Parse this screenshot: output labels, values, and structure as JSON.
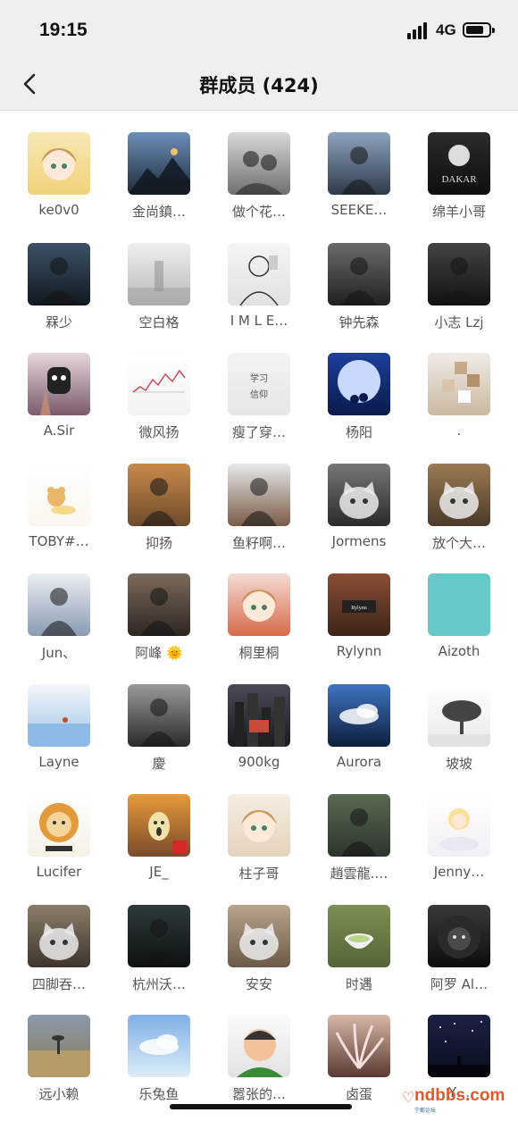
{
  "status_bar": {
    "time": "19:15",
    "network": "4G",
    "battery_percent": 80
  },
  "nav": {
    "title": "群成员 (424)",
    "back_icon": "chevron-left-icon"
  },
  "members": [
    {
      "name": "ke0v0",
      "bg1": "#f6e7b4",
      "bg2": "#f1d27a",
      "motif": "anime"
    },
    {
      "name": "金尚鎮…",
      "bg1": "#6c8fb8",
      "bg2": "#1f2a3b",
      "motif": "mountain"
    },
    {
      "name": "做个花…",
      "bg1": "#d9d9d9",
      "bg2": "#6f6f6f",
      "motif": "people"
    },
    {
      "name": "SEEKE…",
      "bg1": "#8fa3be",
      "bg2": "#2f3a4a",
      "motif": "person"
    },
    {
      "name": "绵羊小哥",
      "bg1": "#2b2b2b",
      "bg2": "#0f0f0f",
      "motif": "logo"
    },
    {
      "name": "槑少",
      "bg1": "#3e5166",
      "bg2": "#0f1820",
      "motif": "person"
    },
    {
      "name": "空白格",
      "bg1": "#eeeeee",
      "bg2": "#b9b9b9",
      "motif": "mist"
    },
    {
      "name": "I M L E…",
      "bg1": "#f5f5f5",
      "bg2": "#e1e1e1",
      "motif": "sketch"
    },
    {
      "name": "钟先森",
      "bg1": "#6b6b6b",
      "bg2": "#202020",
      "motif": "person"
    },
    {
      "name": "小志 Lzj",
      "bg1": "#444444",
      "bg2": "#111111",
      "motif": "person"
    },
    {
      "name": "A.Sir",
      "bg1": "#e7d7df",
      "bg2": "#7a5a6b",
      "motif": "mask"
    },
    {
      "name": "微风扬",
      "bg1": "#ffffff",
      "bg2": "#f2f2f2",
      "motif": "chart"
    },
    {
      "name": "瘦了穿…",
      "bg1": "#f3f3f3",
      "bg2": "#e6e6e6",
      "motif": "text"
    },
    {
      "name": "杨阳",
      "bg1": "#1d3f9c",
      "bg2": "#0a1a4a",
      "motif": "moon"
    },
    {
      "name": ".",
      "bg1": "#f0ece6",
      "bg2": "#c9b8a2",
      "motif": "blocks"
    },
    {
      "name": "TOBY#…",
      "bg1": "#ffffff",
      "bg2": "#fbf6ee",
      "motif": "bear"
    },
    {
      "name": "抑扬",
      "bg1": "#c98a4b",
      "bg2": "#6e4a2b",
      "motif": "person"
    },
    {
      "name": "鱼籽啊…",
      "bg1": "#e9e9e9",
      "bg2": "#7a5b48",
      "motif": "person"
    },
    {
      "name": "Jormens",
      "bg1": "#777777",
      "bg2": "#2a2a2a",
      "motif": "cat"
    },
    {
      "name": "放个大…",
      "bg1": "#9c7a52",
      "bg2": "#4a3a2a",
      "motif": "cat"
    },
    {
      "name": "Jun、",
      "bg1": "#eceff4",
      "bg2": "#8a9bb3",
      "motif": "person"
    },
    {
      "name": "阿峰 🌞",
      "bg1": "#7b6a5b",
      "bg2": "#2e2620",
      "motif": "person"
    },
    {
      "name": "桐里桐",
      "bg1": "#f4dbd4",
      "bg2": "#d76a4a",
      "motif": "anime"
    },
    {
      "name": "Rylynn",
      "bg1": "#8a4e35",
      "bg2": "#3b2418",
      "motif": "label"
    },
    {
      "name": "Aizoth",
      "bg1": "#66c9c7",
      "bg2": "#66c9c7",
      "motif": "plain"
    },
    {
      "name": "Layne",
      "bg1": "#f4f7fb",
      "bg2": "#9ec3e6",
      "motif": "water"
    },
    {
      "name": "慶",
      "bg1": "#9a9a9a",
      "bg2": "#2a2a2a",
      "motif": "person"
    },
    {
      "name": "900kg",
      "bg1": "#4a4a5a",
      "bg2": "#1a1a22",
      "motif": "city"
    },
    {
      "name": "Aurora",
      "bg1": "#3f74c2",
      "bg2": "#0d1f3c",
      "motif": "cloud"
    },
    {
      "name": "坡坡",
      "bg1": "#ffffff",
      "bg2": "#e9e9e9",
      "motif": "tree"
    },
    {
      "name": "Lucifer",
      "bg1": "#ffffff",
      "bg2": "#f6f1e6",
      "motif": "lion"
    },
    {
      "name": "JE_",
      "bg1": "#e79a3a",
      "bg2": "#7a4a2a",
      "motif": "scream"
    },
    {
      "name": "柱子哥",
      "bg1": "#f4ede3",
      "bg2": "#e5d3bd",
      "motif": "anime"
    },
    {
      "name": "趙雲龍.…",
      "bg1": "#5a6a52",
      "bg2": "#2c342a",
      "motif": "person"
    },
    {
      "name": "Jenny…",
      "bg1": "#ffffff",
      "bg2": "#f3eef6",
      "motif": "girl"
    },
    {
      "name": "四脚吞…",
      "bg1": "#8b7d6c",
      "bg2": "#3e352c",
      "motif": "cat"
    },
    {
      "name": "杭州沃…",
      "bg1": "#2d3a3c",
      "bg2": "#0d1112",
      "motif": "person"
    },
    {
      "name": "安安",
      "bg1": "#b9a48c",
      "bg2": "#6b5a48",
      "motif": "cat"
    },
    {
      "name": "时遇",
      "bg1": "#7d8f54",
      "bg2": "#556535",
      "motif": "cup"
    },
    {
      "name": "阿罗 Al…",
      "bg1": "#3a3a3a",
      "bg2": "#0d0d0d",
      "motif": "lion-dark"
    },
    {
      "name": "远小赖",
      "bg1": "#8a9aab",
      "bg2": "#8a7a5a",
      "motif": "field"
    },
    {
      "name": "乐兔鱼",
      "bg1": "#7fb0e6",
      "bg2": "#dcecf8",
      "motif": "cloud"
    },
    {
      "name": "嚣张的…",
      "bg1": "#fbfbfb",
      "bg2": "#e2e2e2",
      "motif": "cartoon"
    },
    {
      "name": "卤蛋",
      "bg1": "#d9b7a8",
      "bg2": "#5a3a32",
      "motif": "feather"
    },
    {
      "name": "Y…",
      "bg1": "#1a2244",
      "bg2": "#0a0d1c",
      "motif": "stars"
    }
  ],
  "watermark": {
    "text": "ndbbs.com",
    "sub": "宁都论坛"
  }
}
